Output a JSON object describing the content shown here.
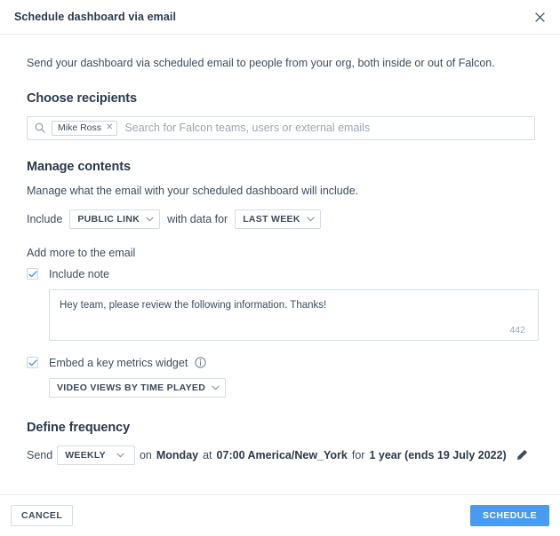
{
  "header": {
    "title": "Schedule dashboard via email",
    "close_icon": "close-icon"
  },
  "body": {
    "intro": "Send your dashboard via scheduled email to people from your org, both inside or out of Falcon.",
    "recipients": {
      "heading": "Choose recipients",
      "search_icon": "search-icon",
      "chips": [
        {
          "label": "Mike Ross",
          "remove_icon": "close-icon"
        }
      ],
      "placeholder": "Search for Falcon teams, users or external emails",
      "value": ""
    },
    "manage_contents": {
      "heading": "Manage contents",
      "subtitle": "Manage what the email with your scheduled dashboard will include.",
      "include_label": "Include",
      "include_select": "PUBLIC LINK",
      "with_data_label": "with data for",
      "data_select": "LAST WEEK",
      "add_more_label": "Add more to the email",
      "include_note": {
        "label": "Include note",
        "checked": true,
        "note_text": "Hey team, please review the following information. Thanks!",
        "char_count": "442"
      },
      "embed_widget": {
        "label": "Embed a key metrics widget",
        "checked": true,
        "info_icon": "info-icon",
        "widget_select": "VIDEO VIEWS BY TIME PLAYED"
      }
    },
    "frequency": {
      "heading": "Define frequency",
      "send_label": "Send",
      "frequency_select": "WEEKLY",
      "on_label": "on",
      "day": "Monday",
      "at_label": "at",
      "time": "07:00 America/New_York",
      "for_label": "for",
      "duration": "1 year (ends 19 July 2022)",
      "edit_icon": "pencil-icon"
    }
  },
  "footer": {
    "cancel_label": "CANCEL",
    "schedule_label": "SCHEDULE"
  },
  "colors": {
    "primary": "#4a9bf0",
    "text": "#3e4d5c",
    "heading": "#2b3a4a",
    "border": "#d5dce2"
  }
}
